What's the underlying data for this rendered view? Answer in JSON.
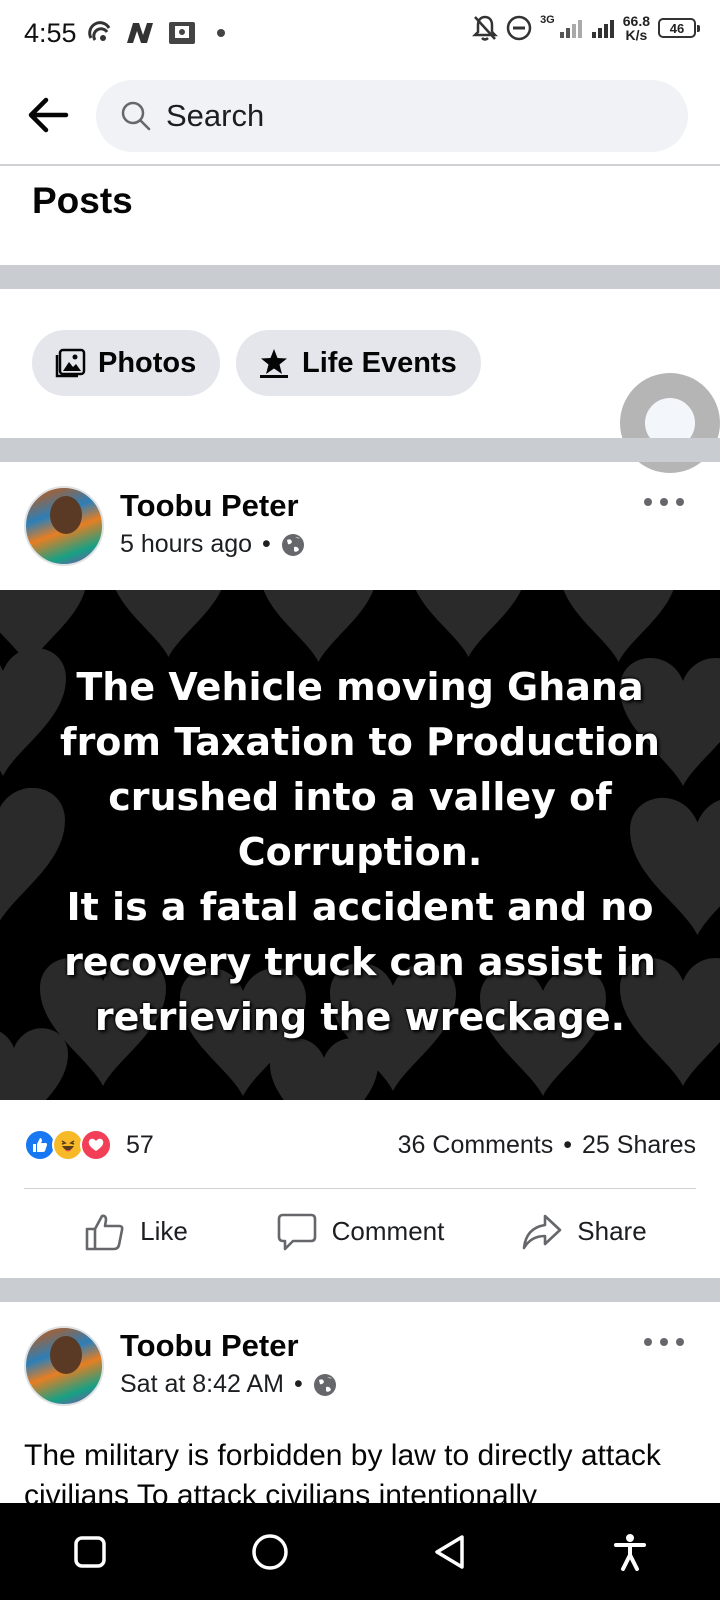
{
  "status_bar": {
    "time": "4:55",
    "net_speed_value": "66.8",
    "net_speed_unit": "K/s",
    "network_label": "3G",
    "battery": "46"
  },
  "search": {
    "placeholder": "Search"
  },
  "section_title": "Posts",
  "filters": {
    "photos": "Photos",
    "life_events": "Life Events"
  },
  "posts": [
    {
      "author": "Toobu Peter",
      "time": "5 hours ago",
      "image_text": "The Vehicle moving Ghana\nfrom Taxation to Production\ncrushed into a valley of\nCorruption.\nIt is a fatal accident and no\nrecovery truck can assist in\nretrieving the wreckage.",
      "reaction_count": "57",
      "comments": "36 Comments",
      "shares": "25 Shares",
      "actions": {
        "like": "Like",
        "comment": "Comment",
        "share": "Share"
      }
    },
    {
      "author": "Toobu Peter",
      "time": "Sat at 8:42 AM",
      "text": "The military is forbidden by law to directly attack civilians To attack civilians intentionally"
    }
  ],
  "colors": {
    "like_blue": "#1877f2",
    "love_red": "#f33e58",
    "haha_yellow": "#f7b928",
    "divider": "#c9ccd1",
    "chip_bg": "#e4e6eb"
  }
}
